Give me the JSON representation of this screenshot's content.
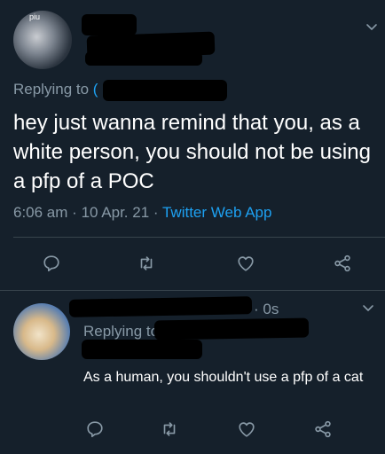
{
  "tweet1": {
    "avatar_label": "piu",
    "replying_label": "Replying to",
    "replying_handle": "(",
    "text": "hey just wanna remind that you, as a white person, you should not be using a pfp of a POC",
    "time": "6:06 am",
    "date": "10 Apr. 21",
    "source": "Twitter Web App",
    "sep": "·"
  },
  "tweet2": {
    "time_suffix": "· 0s",
    "replying_label": "Replying to",
    "text": "As a human, you shouldn't use a pfp of a cat"
  },
  "icons": [
    "reply-icon",
    "retweet-icon",
    "like-icon",
    "share-icon",
    "chevron-down-icon"
  ],
  "colors": {
    "background": "#15202b",
    "muted": "#8899a6",
    "link": "#1da1f2",
    "divider": "#38444d"
  }
}
